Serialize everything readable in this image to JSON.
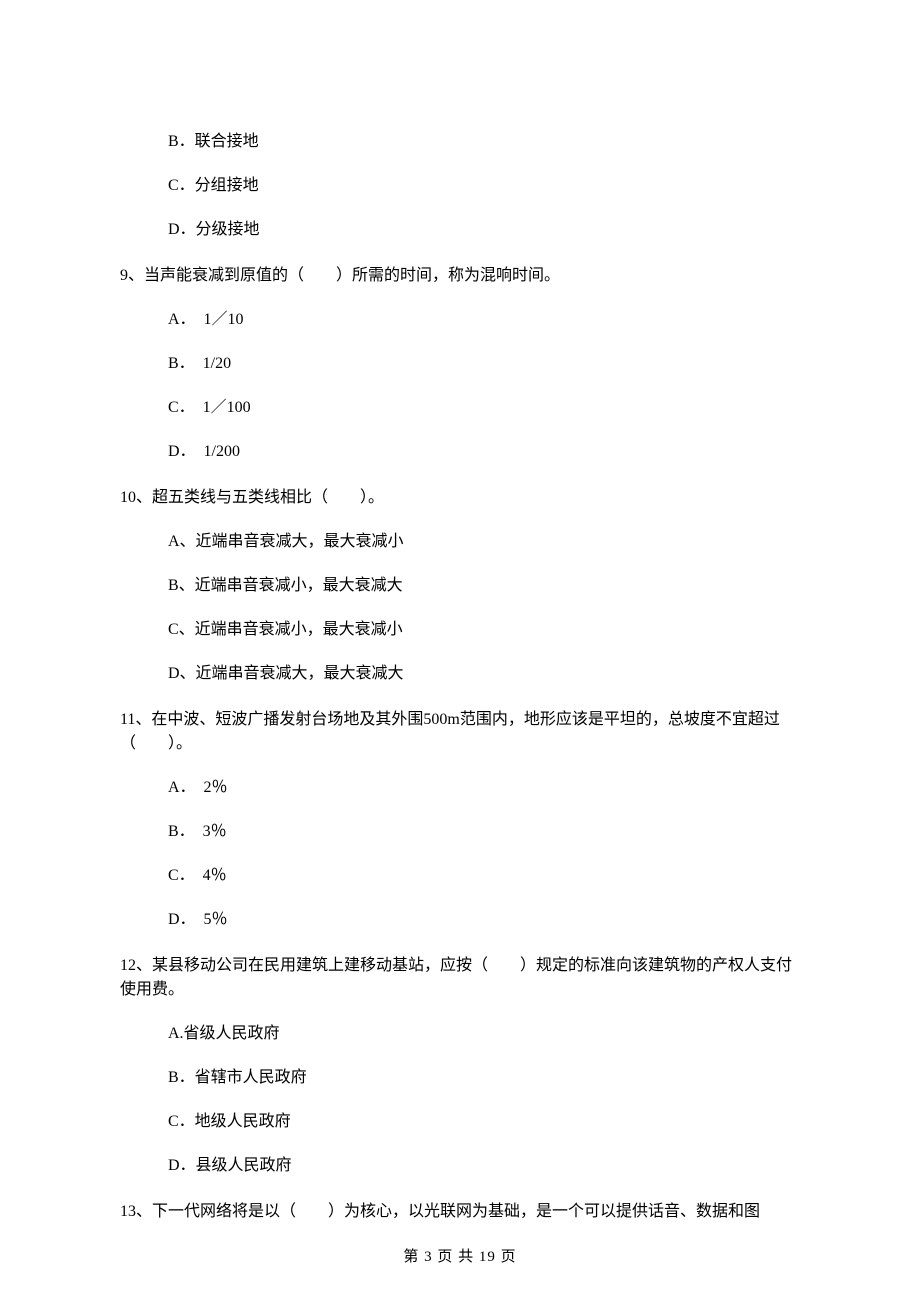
{
  "orphan_options": {
    "b": "B．联合接地",
    "c": "C．分组接地",
    "d": "D．分级接地"
  },
  "q9": {
    "text": "9、当声能衰减到原值的（　　）所需的时间，称为混响时间。",
    "a": "A．　1／10",
    "b": "B．　1/20",
    "c": "C．　1／100",
    "d": "D．　1/200"
  },
  "q10": {
    "text": "10、超五类线与五类线相比（　　）。",
    "a": "A、近端串音衰减大，最大衰减小",
    "b": "B、近端串音衰减小，最大衰减大",
    "c": "C、近端串音衰减小，最大衰减小",
    "d": "D、近端串音衰减大，最大衰减大"
  },
  "q11": {
    "text": "11、在中波、短波广播发射台场地及其外围500m范围内，地形应该是平坦的，总坡度不宜超过（　　）。",
    "a": "A．　2％",
    "b": "B．　3％",
    "c": "C．　4％",
    "d": "D．　5％"
  },
  "q12": {
    "text": "12、某县移动公司在民用建筑上建移动基站，应按（　　）规定的标准向该建筑物的产权人支付使用费。",
    "a": "A.省级人民政府",
    "b": "B．省辖市人民政府",
    "c": "C．地级人民政府",
    "d": "D．县级人民政府"
  },
  "q13": {
    "text": "13、下一代网络将是以（　　）为核心，以光联网为基础，是一个可以提供话音、数据和图"
  },
  "footer": "第 3 页 共 19 页"
}
